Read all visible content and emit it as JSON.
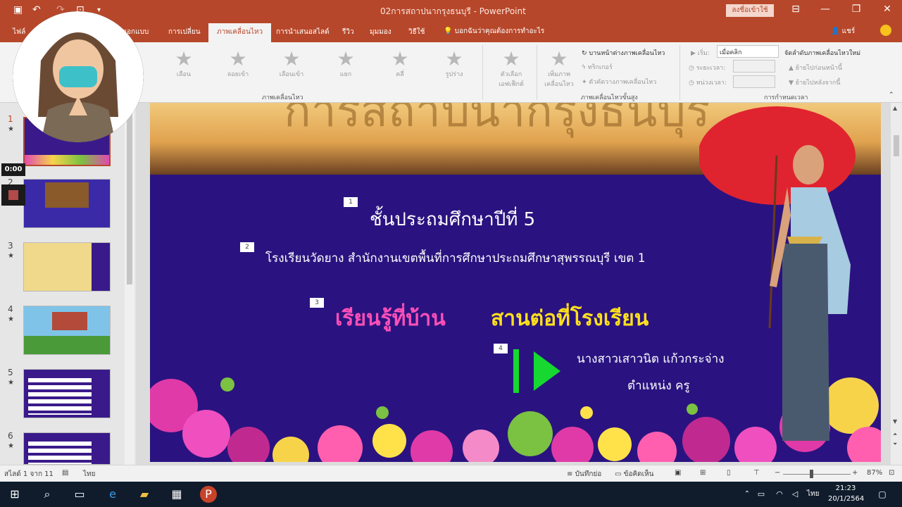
{
  "titlebar": {
    "title": "02การสถาปนากรุงธนบุรี  -  PowerPoint",
    "signin": "ลงชื่อเข้าใช้"
  },
  "tabs": {
    "file": "ไฟล์",
    "design": "ออกแบบ",
    "transitions": "การเปลี่ยน",
    "animations": "ภาพเคลื่อนไหว",
    "slideshow": "การนำเสนอสไลด์",
    "review": "รีวิว",
    "view": "มุมมอง",
    "help": "วิธีใช้",
    "tell_me": "บอกฉันว่าคุณต้องการทำอะไร",
    "share": "แชร์"
  },
  "ribbon": {
    "effects": [
      "เลือน",
      "ลอยเข้า",
      "เลือนเข้า",
      "แยก",
      "คลี่",
      "รูปร่าง"
    ],
    "effect_options": "ตัวเลือกเอฟเฟ็กต์",
    "group_animation": "ภาพเคลื่อนไหว",
    "add_animation": "เพิ่มภาพเคลื่อนไหว",
    "animation_pane": "บานหน้าต่างภาพเคลื่อนไหว",
    "trigger": "ทริกเกอร์",
    "anim_painter": "ตัวคัดวางภาพเคลื่อนไหว",
    "group_advanced": "ภาพเคลื่อนไหวขั้นสูง",
    "start_label": "เริ่ม:",
    "start_value": "เมื่อคลิก",
    "duration_label": "ระยะเวลา:",
    "delay_label": "หน่วงเวลา:",
    "reorder_title": "จัดลำดับภาพเคลื่อนไหวใหม่",
    "move_earlier": "ย้ายไปก่อนหน้านี้",
    "move_later": "ย้ายไปหลังจากนี้",
    "group_timing": "การกำหนดเวลา"
  },
  "thumbs": [
    {
      "num": "1",
      "star": "★",
      "selected": true
    },
    {
      "num": "2",
      "star": "",
      "selected": false
    },
    {
      "num": "3",
      "star": "★",
      "selected": false
    },
    {
      "num": "4",
      "star": "★",
      "selected": false
    },
    {
      "num": "5",
      "star": "★",
      "selected": false
    },
    {
      "num": "6",
      "star": "★",
      "selected": false
    }
  ],
  "slide": {
    "banner_title": "การสถาปนากรุงธนบุรี",
    "tag1": "1",
    "grade": "ชั้นประถมศึกษาปีที่ 5",
    "tag2": "2",
    "school": "โรงเรียนวัดยาง สำนักงานเขตพื้นที่การศึกษาประถมศึกษาสุพรรณบุรี เขต 1",
    "tag3": "3",
    "learn": "เรียนรู้ที่บ้าน",
    "continue": "สานต่อที่โรงเรียน",
    "tag4": "4",
    "teacher": "นางสาวเสาวนิต  แก้วกระจ่าง",
    "position": "ตำแหน่ง ครู"
  },
  "status": {
    "slide_of": "สไลด์ 1 จาก 11",
    "lang": "ไทย",
    "notes": "บันทึกย่อ",
    "comments": "ข้อคิดเห็น",
    "zoom": "87%"
  },
  "taskbar": {
    "time": "21:23",
    "date": "20/1/2564",
    "lang": "ไทย"
  },
  "recorder": {
    "timer": "0:00"
  },
  "colors": {
    "accent": "#b7472a",
    "slide_bg": "#2a1380",
    "pink": "#ff4fb8",
    "yellow": "#ffe01c",
    "play_green": "#16d830"
  }
}
